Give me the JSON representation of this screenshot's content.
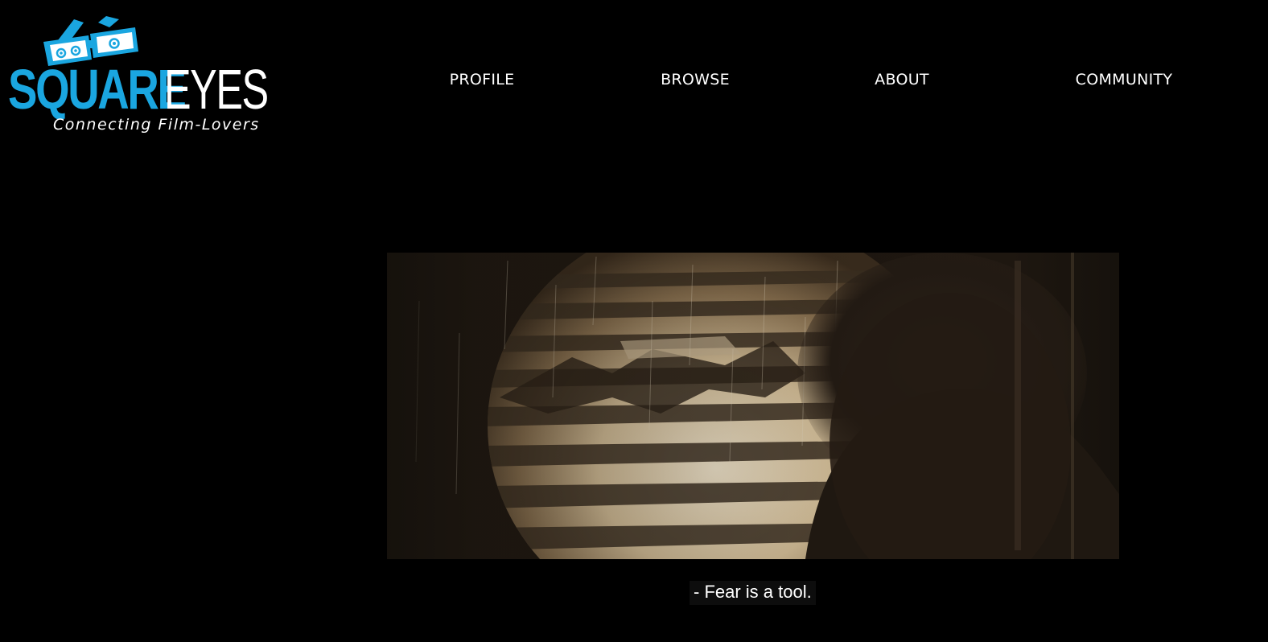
{
  "logo": {
    "word_1": "SQUARE",
    "word_2": "EYES",
    "tagline": "Connecting Film-Lovers",
    "icon": "3d-glasses-icon",
    "brand_color": "#1aa6e0"
  },
  "nav": {
    "items": [
      {
        "label": "PROFILE"
      },
      {
        "label": "BROWSE"
      },
      {
        "label": "ABOUT"
      },
      {
        "label": "COMMUNITY"
      }
    ]
  },
  "video": {
    "subtitle": "- Fear is a tool."
  },
  "colors": {
    "background": "#000000",
    "text": "#ffffff"
  }
}
